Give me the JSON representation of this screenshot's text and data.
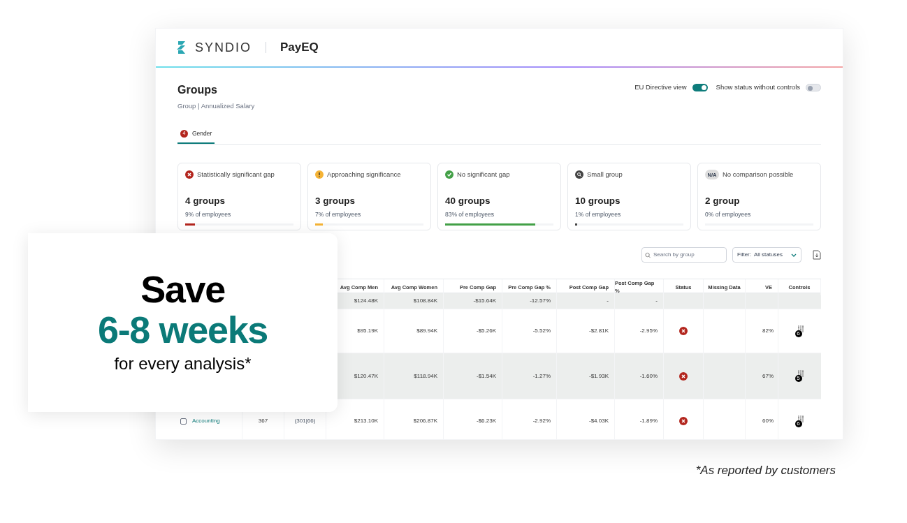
{
  "brand": {
    "logo_text": "SYNDIO",
    "product": "PayEQ"
  },
  "page": {
    "title": "Groups",
    "subtitle": "Group | Annualized Salary"
  },
  "toggles": [
    {
      "label": "EU Directive view",
      "on": true
    },
    {
      "label": "Show status without controls",
      "on": false
    }
  ],
  "tabs": [
    {
      "label": "Gender",
      "badge": "4",
      "selected": true
    }
  ],
  "summary_cards": [
    {
      "kind": "significant",
      "label": "Statistically significant gap",
      "count": "4 groups",
      "percent": "9% of employees",
      "level": 0.09,
      "color": "#b3261e"
    },
    {
      "kind": "approaching",
      "label": "Approaching significance",
      "count": "3 groups",
      "percent": "7% of employees",
      "level": 0.07,
      "color": "#f5b335"
    },
    {
      "kind": "none",
      "label": "No significant gap",
      "count": "40 groups",
      "percent": "83% of employees",
      "level": 0.83,
      "color": "#43a047"
    },
    {
      "kind": "small",
      "label": "Small group",
      "count": "10 groups",
      "percent": "1% of employees",
      "level": 0.02,
      "color": "#444444"
    },
    {
      "kind": "na",
      "label": "No comparison possible",
      "icon_text": "N/A",
      "count": "2 group",
      "percent": "0% of employees",
      "level": 0,
      "color": "#dddddd"
    }
  ],
  "table": {
    "search": {
      "placeholder": "Search by group"
    },
    "filter": {
      "label": "Filter:",
      "value": "All statuses"
    },
    "columns": [
      "Avg Comp Men",
      "Avg Comp Women",
      "Pre Comp Gap",
      "Pre Comp Gap %",
      "Post Comp Gap",
      "Post Comp Gap %",
      "Status",
      "Missing Data",
      "VE",
      "Controls"
    ],
    "rows": [
      {
        "kind": "overall",
        "highlighted": true,
        "values": [
          "$124.48K",
          "$108.84K",
          "-$15.64K",
          "-12.57%",
          "-",
          "-"
        ]
      },
      {
        "kind": "group",
        "highlighted": false,
        "values": [
          "$95.19K",
          "$89.94K",
          "-$5.26K",
          "-5.52%",
          "-$2.81K",
          "-2.95%"
        ],
        "significant_gap": true,
        "ve": "82%",
        "controls_badge": "6"
      },
      {
        "kind": "group",
        "highlighted": true,
        "values": [
          "$120.47K",
          "$118.94K",
          "-$1.54K",
          "-1.27%",
          "-$1.93K",
          "-1.60%"
        ],
        "significant_gap": true,
        "ve": "67%",
        "controls_badge": "5"
      },
      {
        "kind": "group",
        "highlighted": false,
        "checked": false,
        "group": "Accounting",
        "headcount": "367",
        "mw": "(301|66)",
        "values": [
          "$213.10K",
          "$206.87K",
          "-$6.23K",
          "-2.92%",
          "-$4.03K",
          "-1.89%"
        ],
        "significant_gap": true,
        "ve": "60%",
        "controls_badge": "6"
      }
    ]
  },
  "promo": {
    "headline": "Save",
    "highlight": "6-8 weeks",
    "subline": "for every analysis*"
  },
  "footnote": "*As reported by customers"
}
